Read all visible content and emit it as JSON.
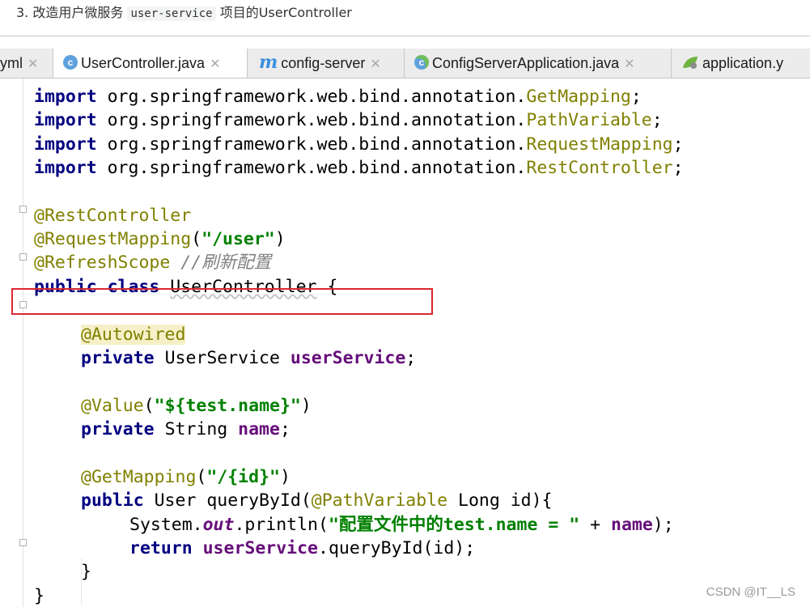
{
  "caption": {
    "prefix": "3. 改造用户微服务 ",
    "code": "user-service",
    "suffix": " 项目的UserController"
  },
  "tabs": [
    {
      "label": "yml",
      "icon": "yaml-file-icon"
    },
    {
      "label": "UserController.java",
      "icon": "java-class-icon",
      "active": true
    },
    {
      "label": "config-server",
      "icon": "maven-module-icon"
    },
    {
      "label": "ConfigServerApplication.java",
      "icon": "spring-class-icon"
    },
    {
      "label": "application.y",
      "icon": "spring-config-icon"
    }
  ],
  "code": {
    "import1": {
      "kw": "import",
      "pkg": " org.springframework.web.bind.annotation.",
      "cls": "GetMapping",
      "end": ";"
    },
    "import2": {
      "kw": "import",
      "pkg": " org.springframework.web.bind.annotation.",
      "cls": "PathVariable",
      "end": ";"
    },
    "import3": {
      "kw": "import",
      "pkg": " org.springframework.web.bind.annotation.",
      "cls": "RequestMapping",
      "end": ";"
    },
    "import4": {
      "kw": "import",
      "pkg": " org.springframework.web.bind.annotation.",
      "cls": "RestController",
      "end": ";"
    },
    "rest_controller": "@RestController",
    "request_mapping": {
      "ann": "@RequestMapping",
      "open": "(",
      "str": "\"/user\"",
      "close": ")"
    },
    "refresh_scope": {
      "ann": "@RefreshScope",
      "comment": " //刷新配置"
    },
    "class_decl": {
      "kw": "public class ",
      "name": "UserController",
      "rest": " {"
    },
    "autowired": "@Autowired",
    "field1": {
      "kw": "private ",
      "type": "UserService ",
      "name": "userService",
      "end": ";"
    },
    "value_ann": {
      "ann": "@Value",
      "open": "(",
      "str": "\"${test.name}\"",
      "close": ")"
    },
    "field2": {
      "kw": "private ",
      "type": "String ",
      "name": "name",
      "end": ";"
    },
    "get_mapping": {
      "ann": "@GetMapping",
      "open": "(",
      "str": "\"/{id}\"",
      "close": ")"
    },
    "method_decl": {
      "kw": "public ",
      "pre": "User queryById(",
      "ann": "@PathVariable",
      "post": " Long id){"
    },
    "println": {
      "obj": "System.",
      "out": "out",
      "call": ".println(",
      "str": "\"配置文件中的test.name = \"",
      "plus": " + ",
      "name": "name",
      "end": ");"
    },
    "return_stmt": {
      "kw": "return ",
      "field": "userService",
      "rest": ".queryById(id);"
    },
    "close_method": "}",
    "close_class": "}"
  },
  "watermark": "CSDN @IT__LS"
}
